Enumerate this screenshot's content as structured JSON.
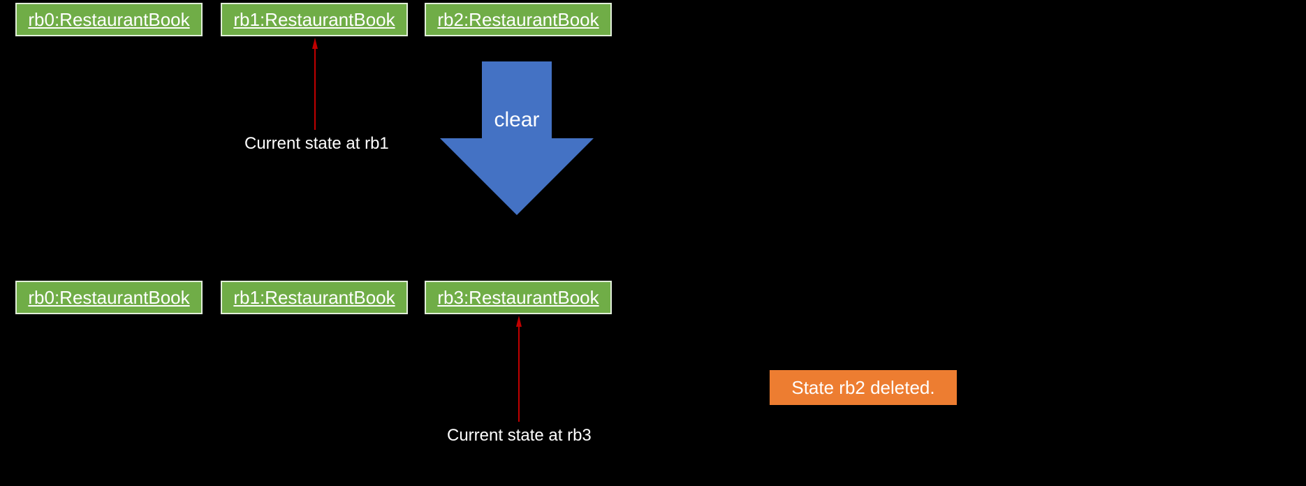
{
  "topRow": {
    "b0": "rb0:RestaurantBook",
    "b1": "rb1:RestaurantBook",
    "b2": "rb2:RestaurantBook"
  },
  "bottomRow": {
    "b0": "rb0:RestaurantBook",
    "b1": "rb1:RestaurantBook",
    "b3": "rb3:RestaurantBook"
  },
  "action": {
    "label": "clear"
  },
  "pointerTop": "Current state at rb1",
  "pointerBottom": "Current state at rb3",
  "note": "State rb2 deleted."
}
